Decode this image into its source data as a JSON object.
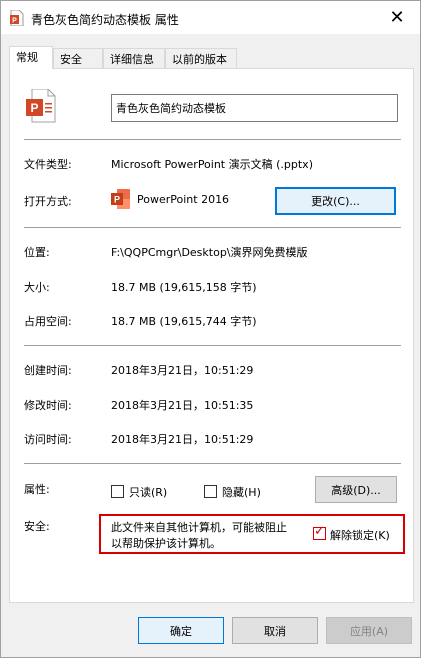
{
  "window": {
    "title": "青色灰色简约动态模板 属性",
    "close_glyph": "✕"
  },
  "tabs": [
    {
      "label": "常规",
      "active": true
    },
    {
      "label": "安全",
      "active": false
    },
    {
      "label": "详细信息",
      "active": false
    },
    {
      "label": "以前的版本",
      "active": false
    }
  ],
  "general": {
    "filename": "青色灰色简约动态模板",
    "file_type_label": "文件类型:",
    "file_type_value": "Microsoft PowerPoint 演示文稿 (.pptx)",
    "open_with_label": "打开方式:",
    "open_with_value": "PowerPoint 2016",
    "change_button": "更改(C)...",
    "location_label": "位置:",
    "location_value": "F:\\QQPCmgr\\Desktop\\演界网免费模版",
    "size_label": "大小:",
    "size_value": "18.7 MB (19,615,158 字节)",
    "disk_size_label": "占用空间:",
    "disk_size_value": "18.7 MB (19,615,744 字节)",
    "created_label": "创建时间:",
    "created_value": "2018年3月21日，10:51:29",
    "modified_label": "修改时间:",
    "modified_value": "2018年3月21日，10:51:35",
    "accessed_label": "访问时间:",
    "accessed_value": "2018年3月21日，10:51:29",
    "attributes_label": "属性:",
    "readonly_label": "只读(R)",
    "readonly_checked": false,
    "hidden_label": "隐藏(H)",
    "hidden_checked": false,
    "advanced_button": "高级(D)...",
    "security_label": "安全:",
    "security_message_line1": "此文件来自其他计算机，可能被阻止",
    "security_message_line2": "以帮助保护该计算机。",
    "unblock_label": "解除锁定(K)",
    "unblock_checked": true,
    "unblock_check_glyph": "✓"
  },
  "footer": {
    "ok_button": "确定",
    "cancel_button": "取消",
    "apply_button": "应用(A)"
  },
  "colors": {
    "powerpoint_orange": "#d24726",
    "highlight_red": "#d60000",
    "accent_blue": "#0078d7"
  }
}
